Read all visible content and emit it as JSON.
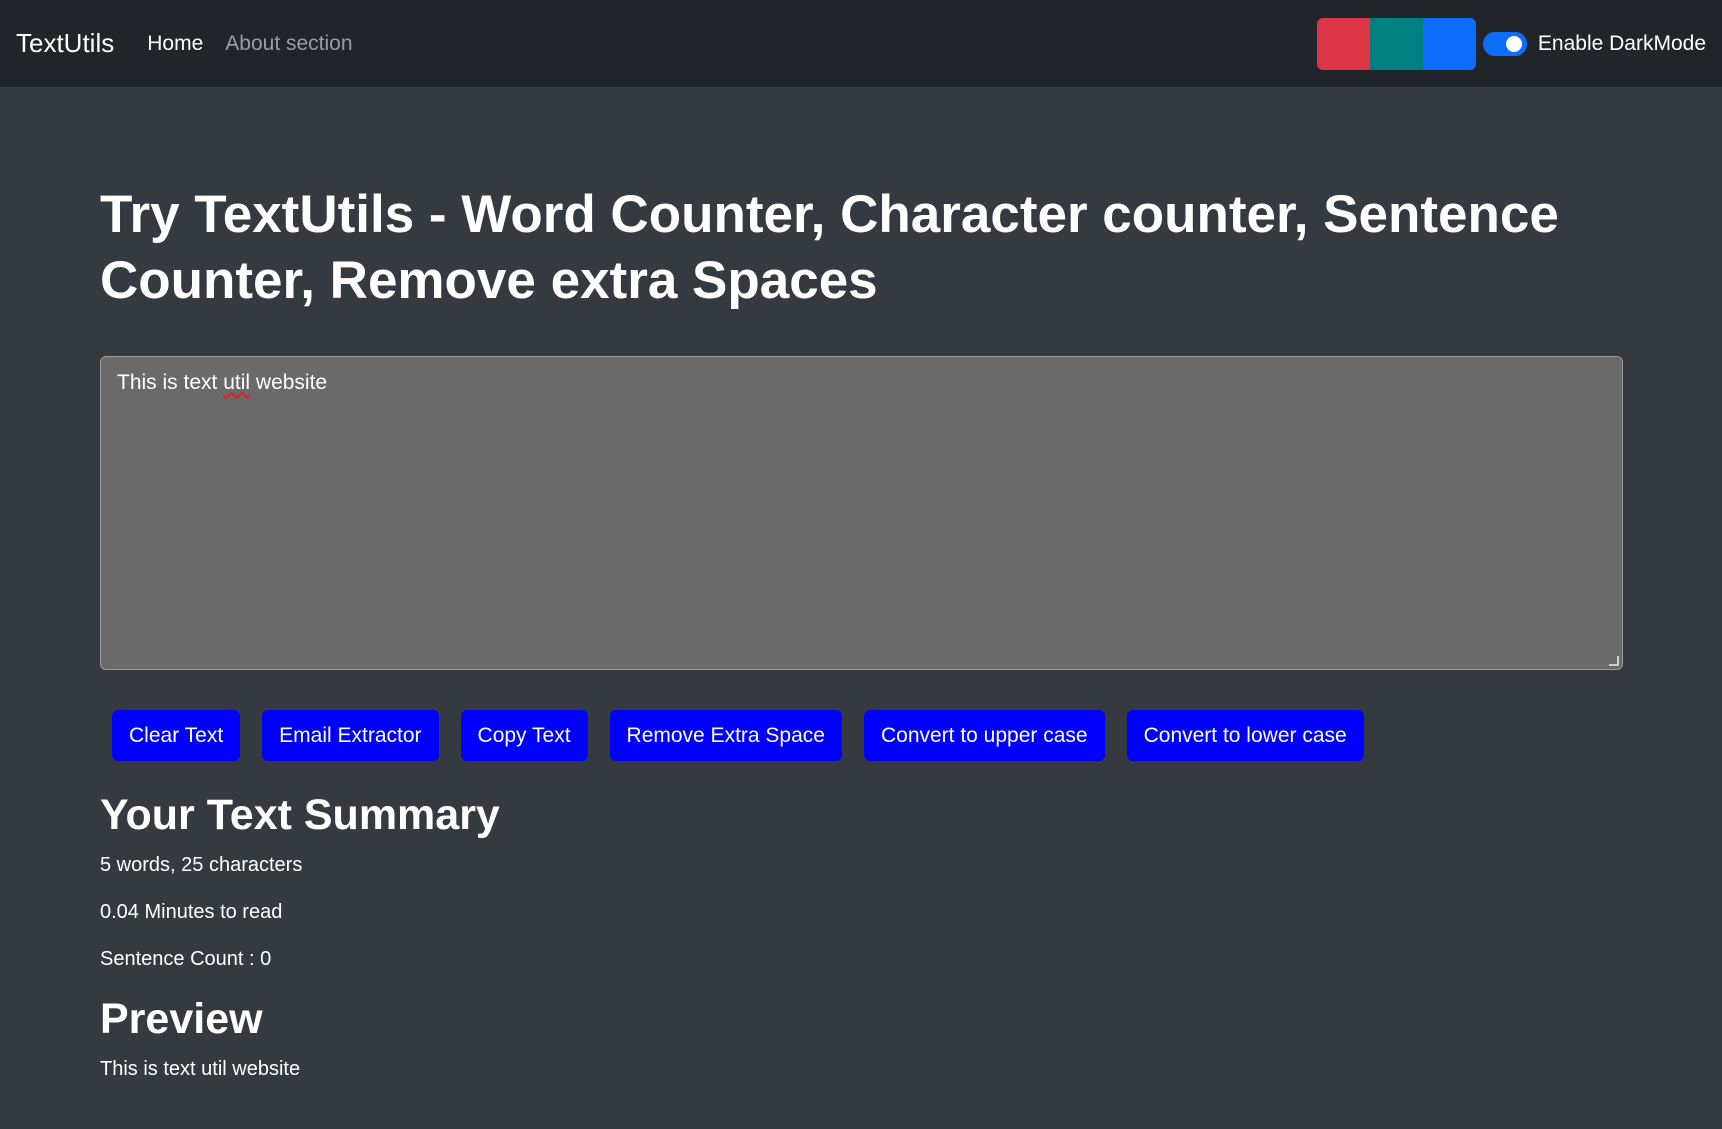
{
  "navbar": {
    "brand": "TextUtils",
    "links": [
      {
        "label": "Home"
      },
      {
        "label": "About section"
      }
    ],
    "theme_swatches": [
      {
        "name": "red",
        "color": "#dc3545"
      },
      {
        "name": "teal",
        "color": "#008080"
      },
      {
        "name": "blue",
        "color": "#0d6efd"
      }
    ],
    "darkmode_toggle": {
      "label": "Enable DarkMode",
      "checked": true
    }
  },
  "main": {
    "title": "Try TextUtils - Word Counter, Character counter, Sentence Counter, Remove extra Spaces",
    "textarea": {
      "text_before": "This is text ",
      "text_misspelled": "util",
      "text_after": " website"
    },
    "buttons": [
      {
        "label": "Clear Text"
      },
      {
        "label": "Email Extractor"
      },
      {
        "label": "Copy Text"
      },
      {
        "label": "Remove Extra Space"
      },
      {
        "label": "Convert to upper case"
      },
      {
        "label": "Convert to lower case"
      }
    ],
    "summary": {
      "title": "Your Text Summary",
      "counts": "5 words, 25 characters",
      "read_time": "0.04 Minutes to read",
      "sentence_count": "Sentence Count : 0"
    },
    "preview": {
      "title": "Preview",
      "text": "This is text util website"
    }
  },
  "colors": {
    "navbar_bg": "#212529",
    "page_bg": "#343a40",
    "textarea_bg": "#6a6a6a",
    "button_bg": "#0000ff",
    "toggle_on": "#0d6efd"
  }
}
